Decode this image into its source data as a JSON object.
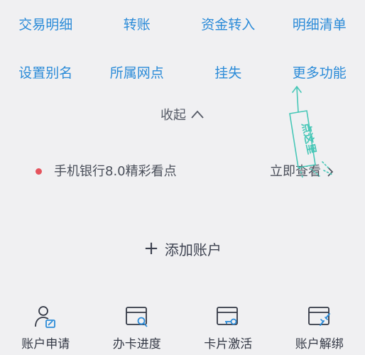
{
  "colors": {
    "blue": "#2b8bd8",
    "accent_teal": "#47c7b7",
    "dot_red": "#e5535d"
  },
  "menu_row1": [
    {
      "label": "交易明细",
      "name": "transaction-details"
    },
    {
      "label": "转账",
      "name": "transfer"
    },
    {
      "label": "资金转入",
      "name": "fund-transfer-in"
    },
    {
      "label": "明细清单",
      "name": "details-list"
    }
  ],
  "menu_row2": [
    {
      "label": "设置别名",
      "name": "set-alias"
    },
    {
      "label": "所属网点",
      "name": "branch"
    },
    {
      "label": "挂失",
      "name": "report-loss"
    },
    {
      "label": "更多功能",
      "name": "more-functions"
    }
  ],
  "collapse": {
    "label": "收起",
    "icon": "chevron-up-icon"
  },
  "promo": {
    "title": "手机银行8.0精彩看点",
    "action": "立即查看"
  },
  "annotation": {
    "text": "点这里"
  },
  "add_account": {
    "label": "添加账户",
    "icon": "plus-icon"
  },
  "bottom_bar": [
    {
      "label": "账户申请",
      "icon": "user-edit-icon"
    },
    {
      "label": "办卡进度",
      "icon": "card-search-icon"
    },
    {
      "label": "卡片激活",
      "icon": "card-key-icon"
    },
    {
      "label": "账户解绑",
      "icon": "card-unlink-icon"
    }
  ]
}
